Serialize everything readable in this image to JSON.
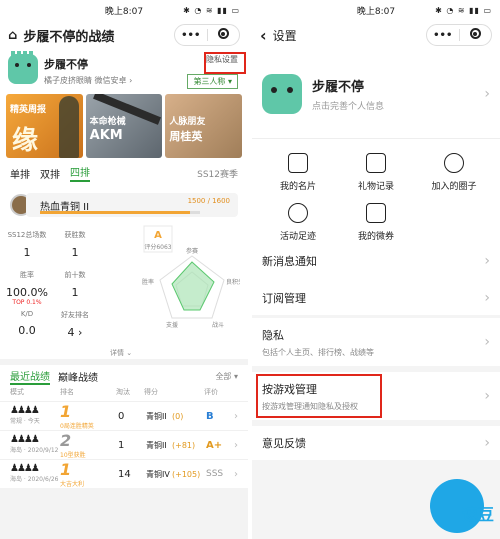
{
  "left": {
    "status_time": "晚上8:07",
    "status_icons": "✱ ◔ ≋ ▮▮ ▭",
    "nav_title": "步履不停的战绩",
    "capsule_more": "•••",
    "profile": {
      "name": "步履不停",
      "sub": "橘子皮挤眼睛  微信安卓 ›",
      "privacy": "隐私设置",
      "third": "第三人称 ▾"
    },
    "cards": [
      {
        "tag": "精英周报",
        "big": "缘"
      },
      {
        "tag": "本命枪械",
        "title": "AKM"
      },
      {
        "tag": "人脉朋友",
        "title": "周桂英"
      }
    ],
    "mode_tabs": [
      "单排",
      "双排",
      "四排"
    ],
    "season": "SS12赛季",
    "rank": {
      "name": "热血青铜 II",
      "value": "1500 / 1600",
      "progress": 0.9375
    },
    "stats": [
      {
        "k": "SS12总场数",
        "v": "1"
      },
      {
        "k": "获胜数",
        "v": "1"
      },
      {
        "k": "胜率",
        "v": "100.0%",
        "extra": "TOP 0.1%"
      },
      {
        "k": "前十数",
        "v": "1"
      },
      {
        "k": "K/D",
        "v": "0.0"
      },
      {
        "k": "好友排名",
        "v": "4 ›"
      }
    ],
    "grade": {
      "letter": "A",
      "score": "评分6063"
    },
    "radar_labels": [
      "参赛",
      "良积分",
      "战斗",
      "支援",
      "胜率"
    ],
    "detail": "详情 ⌄",
    "match_tabs": [
      "最近战绩",
      "巅峰战绩"
    ],
    "match_all": "全部 ▾",
    "col_headers": [
      "模式",
      "排名",
      "淘汰",
      "得分",
      "评价"
    ],
    "matches": [
      {
        "mode": "常规 · 今天",
        "place": "1",
        "note": "0局连胜精英",
        "kills": "0",
        "score": "青铜II",
        "delta": "(0)",
        "grade": "B"
      },
      {
        "mode": "海岛 · 2020/9/12",
        "place": "2",
        "note": "10型获胜",
        "kills": "1",
        "score": "青铜II",
        "delta": "(+81)",
        "grade": "A+"
      },
      {
        "mode": "海岛 · 2020/6/26",
        "place": "1",
        "note": "大吉大利",
        "kills": "14",
        "score": "青铜IV",
        "delta": "(+105)",
        "grade": "SSS"
      }
    ]
  },
  "right": {
    "status_time": "晚上8:07",
    "status_icons": "✱ ◔ ≋ ▮▮ ▭",
    "back": "‹",
    "nav_title": "设置",
    "capsule_more": "•••",
    "name": "步履不停",
    "subtitle": "点击完善个人信息",
    "grid": [
      "我的名片",
      "礼物记录",
      "加入的圈子",
      "活动足迹",
      "我的微券"
    ],
    "menu": [
      {
        "title": "新消息通知",
        "sub": ""
      },
      {
        "title": "订阅管理",
        "sub": ""
      },
      {
        "title": "隐私",
        "sub": "包括个人主页、排行榜、战绩等"
      },
      {
        "title": "按游戏管理",
        "sub": "按游戏管理通知隐私及授权"
      },
      {
        "title": "意见反馈",
        "sub": ""
      }
    ],
    "watermark": "速豆"
  },
  "colors": {
    "highlight": "#e0261a",
    "accent_green": "#2a9d3a",
    "rank_orange": "#f2a534"
  }
}
